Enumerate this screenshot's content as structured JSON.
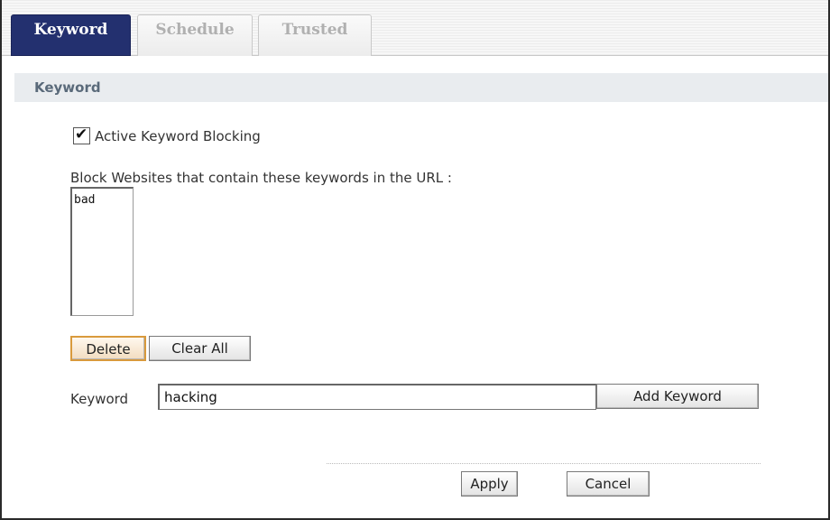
{
  "tabs": [
    {
      "label": "Keyword",
      "active": true
    },
    {
      "label": "Schedule",
      "active": false
    },
    {
      "label": "Trusted",
      "active": false
    }
  ],
  "section": {
    "title": "Keyword"
  },
  "active_blocking": {
    "label": "Active Keyword Blocking",
    "checked": true
  },
  "block_list": {
    "label": "Block Websites that contain these keywords in the URL :",
    "items": [
      "bad"
    ]
  },
  "buttons": {
    "delete": "Delete",
    "clear_all": "Clear All",
    "add_keyword": "Add Keyword",
    "apply": "Apply",
    "cancel": "Cancel"
  },
  "keyword_field": {
    "label": "Keyword",
    "value": "hacking"
  },
  "colors": {
    "active_tab": "#23306f",
    "section_bar": "#e9ecef",
    "focus_border": "#d99a3c"
  }
}
